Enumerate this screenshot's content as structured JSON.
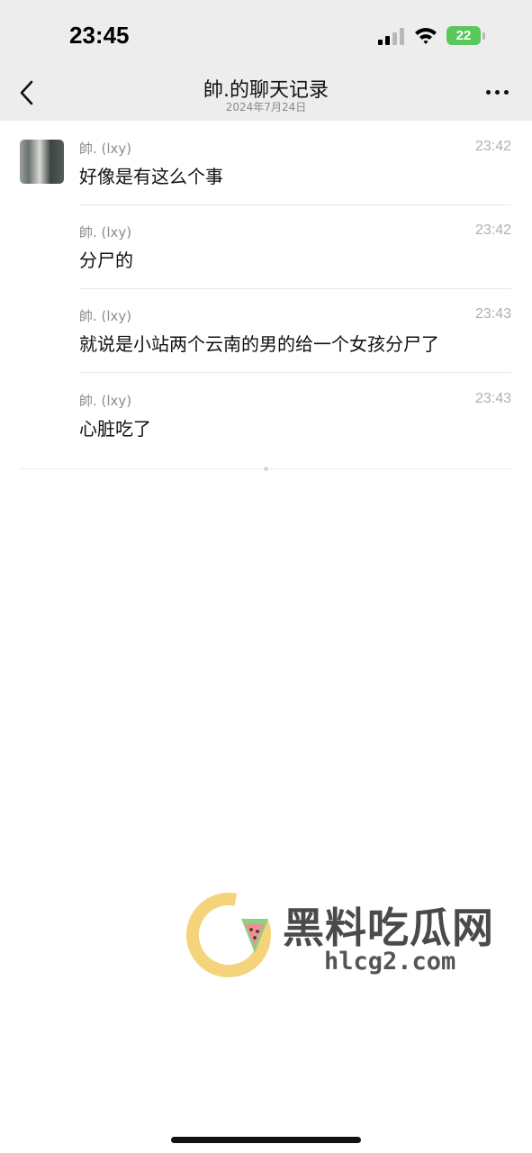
{
  "status_bar": {
    "time": "23:45",
    "battery": "22"
  },
  "nav": {
    "back_icon": "chevron-left-icon",
    "title": "帥.的聊天记录",
    "subtitle": "2024年7月24日",
    "more_icon": "ellipsis-icon"
  },
  "messages": [
    {
      "sender": "帥. (lxy)",
      "time": "23:42",
      "text": "好像是有这么个事"
    },
    {
      "sender": "帥. (lxy)",
      "time": "23:42",
      "text": "分尸的"
    },
    {
      "sender": "帥. (lxy)",
      "time": "23:43",
      "text": "就说是小站两个云南的男的给一个女孩分尸了"
    },
    {
      "sender": "帥. (lxy)",
      "time": "23:43",
      "text": "心脏吃了"
    }
  ],
  "watermark": {
    "title": "黑料吃瓜网",
    "domain": "hlcg2.com"
  },
  "colors": {
    "header_bg": "#ededed",
    "battery": "#58c95a",
    "watermark_yellow": "#f4d37a",
    "watermark_green": "#8fcf86"
  }
}
